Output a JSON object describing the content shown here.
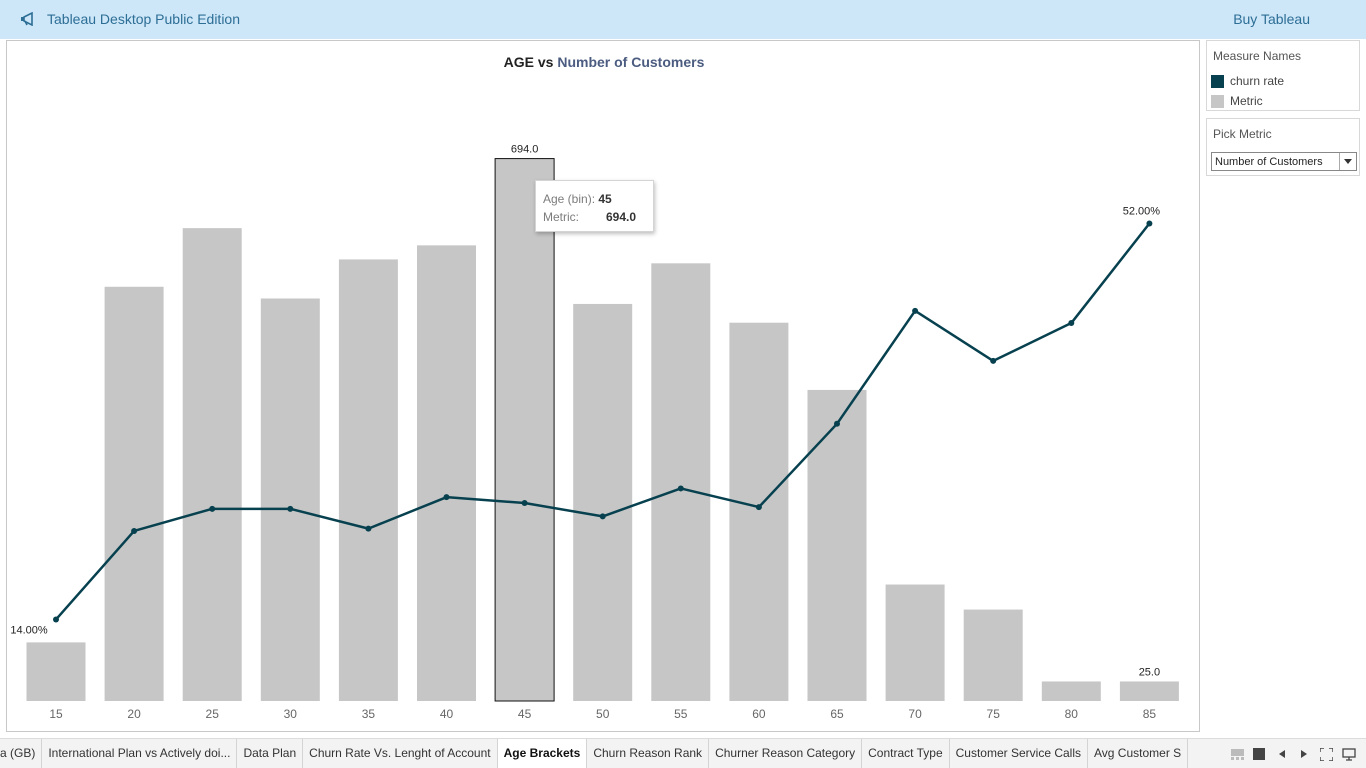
{
  "app": {
    "title": "Tableau Desktop Public Edition",
    "buy_label": "Buy Tableau"
  },
  "colors": {
    "topbar_bg": "#cde7f9",
    "bar_fill": "#c6c6c6",
    "line_color": "#07414f",
    "brand_text": "#2d6e95"
  },
  "chart_data": {
    "type": "bar",
    "title_parts": {
      "dimension": "AGE",
      "vs": "vs",
      "measure": "Number of Customers"
    },
    "categories": [
      "15",
      "20",
      "25",
      "30",
      "35",
      "40",
      "45",
      "50",
      "55",
      "60",
      "65",
      "70",
      "75",
      "80",
      "85"
    ],
    "series": [
      {
        "name": "Metric",
        "type": "bar",
        "values": [
          75,
          530,
          605,
          515,
          565,
          583,
          694,
          508,
          560,
          484,
          398,
          149,
          117,
          25,
          25
        ]
      },
      {
        "name": "churn rate",
        "type": "line",
        "values": [
          14.0,
          29.2,
          33.0,
          33.0,
          29.6,
          35.0,
          34.0,
          31.7,
          36.5,
          33.3,
          47.6,
          67.0,
          58.4,
          64.9,
          82.0
        ]
      }
    ],
    "bar_ylim": [
      0,
      760
    ],
    "line_ylim": [
      0,
      102
    ],
    "data_labels": [
      {
        "series": "Metric",
        "category": "45",
        "text": "694.0"
      },
      {
        "series": "Metric",
        "category": "85",
        "text": "25.0"
      },
      {
        "series": "churn rate",
        "category": "15",
        "text": "14.00%"
      },
      {
        "series": "churn rate",
        "category": "85",
        "text": "52.00%"
      }
    ],
    "highlighted_category": "45",
    "grid": false,
    "xlabel": "",
    "ylabel": ""
  },
  "tooltip": {
    "row1_key": "Age (bin):",
    "row1_val": "45",
    "row2_key": "Metric:",
    "row2_val": "694.0"
  },
  "legend": {
    "title": "Measure Names",
    "items": [
      {
        "label": "churn rate",
        "color": "#07414f"
      },
      {
        "label": "Metric",
        "color": "#c6c6c6"
      }
    ]
  },
  "pick_metric": {
    "title": "Pick Metric",
    "selected": "Number of Customers"
  },
  "tabs": [
    {
      "label": "a (GB)"
    },
    {
      "label": "International Plan vs Actively doi..."
    },
    {
      "label": "Data Plan"
    },
    {
      "label": "Churn Rate Vs. Lenght of Account"
    },
    {
      "label": "Age Brackets",
      "active": true
    },
    {
      "label": "Churn Reason Rank"
    },
    {
      "label": "Churner Reason Category"
    },
    {
      "label": "Contract Type"
    },
    {
      "label": "Customer Service Calls"
    },
    {
      "label": "Avg Customer S"
    }
  ]
}
